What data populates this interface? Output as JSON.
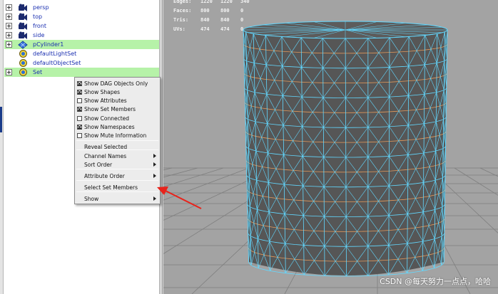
{
  "outliner": {
    "items": [
      {
        "label": "persp",
        "expandable": true,
        "selected": false,
        "icon": "camera-icon"
      },
      {
        "label": "top",
        "expandable": true,
        "selected": false,
        "icon": "camera-icon"
      },
      {
        "label": "front",
        "expandable": true,
        "selected": false,
        "icon": "camera-icon"
      },
      {
        "label": "side",
        "expandable": true,
        "selected": false,
        "icon": "camera-icon"
      },
      {
        "label": "pCylinder1",
        "expandable": true,
        "selected": true,
        "icon": "mesh-transform-icon"
      },
      {
        "label": "defaultLightSet",
        "expandable": false,
        "selected": false,
        "icon": "set-icon"
      },
      {
        "label": "defaultObjectSet",
        "expandable": false,
        "selected": false,
        "icon": "set-icon"
      },
      {
        "label": "Set",
        "expandable": true,
        "selected": true,
        "icon": "set-icon"
      }
    ],
    "selection_color": "#b6f2a8",
    "label_color": "#1a2fb0"
  },
  "context_menu": {
    "items": [
      {
        "label": "Show DAG Objects Only",
        "checkbox": true,
        "checked": true
      },
      {
        "label": "Show Shapes",
        "checkbox": true,
        "checked": true
      },
      {
        "label": "Show Attributes",
        "checkbox": true,
        "checked": false
      },
      {
        "label": "Show Set Members",
        "checkbox": true,
        "checked": true
      },
      {
        "label": "Show Connected",
        "checkbox": true,
        "checked": false
      },
      {
        "label": "Show Namespaces",
        "checkbox": true,
        "checked": true
      },
      {
        "label": "Show Mute Information",
        "checkbox": true,
        "checked": false
      },
      {
        "label": "Reveal Selected",
        "checkbox": false,
        "submenu": false
      },
      {
        "label": "Channel Names",
        "checkbox": false,
        "submenu": true
      },
      {
        "label": "Sort Order",
        "checkbox": false,
        "submenu": true
      },
      {
        "label": "Attribute Order",
        "checkbox": false,
        "submenu": true
      },
      {
        "label": "Select Set Members",
        "checkbox": false,
        "submenu": false
      },
      {
        "label": "Show",
        "checkbox": false,
        "submenu": true
      }
    ]
  },
  "viewport": {
    "hud": [
      {
        "label": "Edges:",
        "values": [
          "1220",
          "1220",
          "340"
        ]
      },
      {
        "label": "Faces:",
        "values": [
          "800",
          "800",
          "0"
        ]
      },
      {
        "label": "Tris:",
        "values": [
          "840",
          "840",
          "0"
        ]
      },
      {
        "label": "UVs:",
        "values": [
          "474",
          "474",
          "0"
        ]
      }
    ],
    "background_color": "#a3a3a3",
    "wire_color": "#62d8ff",
    "edge_loop_color": "#e39a5c",
    "mesh_color": "#565656"
  },
  "annotation": {
    "arrow_color": "#e8231b"
  },
  "watermark": "CSDN @每天努力一点点，哈哈"
}
